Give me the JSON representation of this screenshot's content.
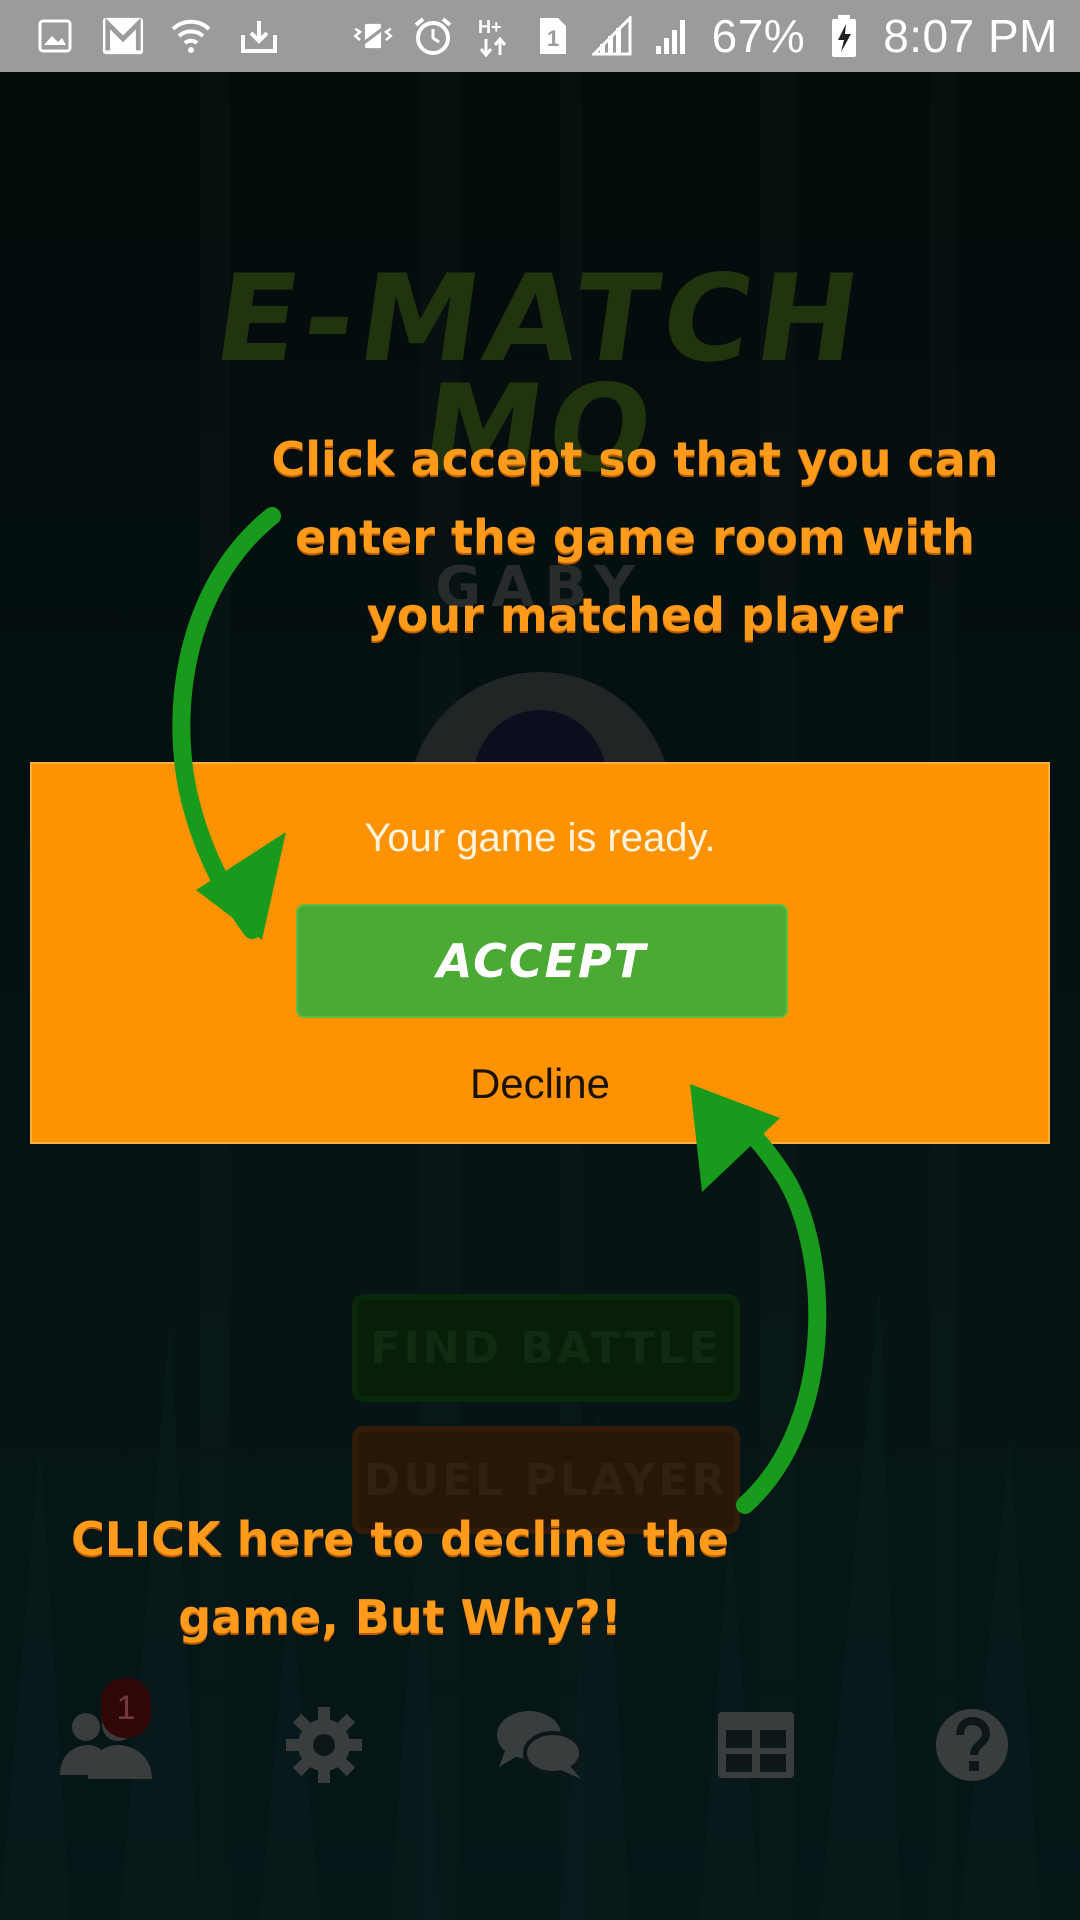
{
  "status_bar": {
    "battery": "67%",
    "time": "8:07 PM",
    "left_icons": [
      "gallery-icon",
      "gmail-icon",
      "wifi-icon",
      "download-icon"
    ],
    "right_icons": [
      "vibrate-icon",
      "alarm-icon",
      "data-hplus-icon",
      "sim1-icon",
      "signal-icon",
      "signal2-icon",
      "battery-charging-icon"
    ]
  },
  "app": {
    "title_line1": "E-MATCH",
    "title_line2": "MO",
    "player_name": "GABY",
    "find_battle_label": "FIND BATTLE",
    "duel_player_label": "DUEL PLAYER"
  },
  "dialog": {
    "message": "Your game is ready.",
    "accept_label": "ACCEPT",
    "decline_label": "Decline",
    "background_color": "#ff9200",
    "accept_color": "#4aaa33"
  },
  "annotations": {
    "top_line1": "Click accept so that you can",
    "top_line2": "enter the game room with",
    "top_line3": "your matched player",
    "bottom_line1": "CLICK here to decline the",
    "bottom_line2": "game, But Why?!",
    "text_color": "#ff9a1a",
    "arrow_color": "#189a1c"
  },
  "bottom_nav": {
    "items": [
      "friends-icon",
      "settings-icon",
      "chat-icon",
      "grid-icon",
      "help-icon"
    ],
    "friends_badge": "1"
  }
}
